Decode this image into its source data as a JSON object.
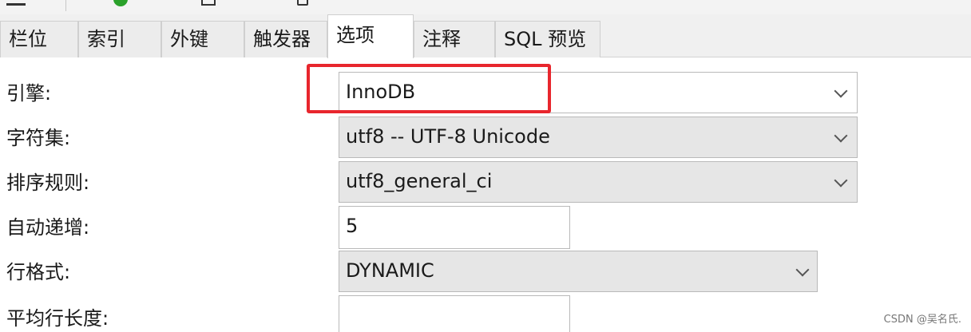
{
  "tabs": [
    {
      "label": "栏位"
    },
    {
      "label": "索引"
    },
    {
      "label": "外键"
    },
    {
      "label": "触发器"
    },
    {
      "label": "选项"
    },
    {
      "label": "注释"
    },
    {
      "label": "SQL 预览"
    }
  ],
  "active_tab": "选项",
  "form": {
    "engine": {
      "label": "引擎:",
      "value": "InnoDB"
    },
    "charset": {
      "label": "字符集:",
      "value": "utf8 -- UTF-8 Unicode"
    },
    "collation": {
      "label": "排序规则:",
      "value": "utf8_general_ci"
    },
    "auto_increment": {
      "label": "自动递增:",
      "value": "5"
    },
    "row_format": {
      "label": "行格式:",
      "value": "DYNAMIC"
    },
    "avg_row_length": {
      "label": "平均行长度:",
      "value": ""
    }
  },
  "annotation": {
    "highlight_color": "#e8262d"
  },
  "watermark": "CSDN @吴名氏."
}
